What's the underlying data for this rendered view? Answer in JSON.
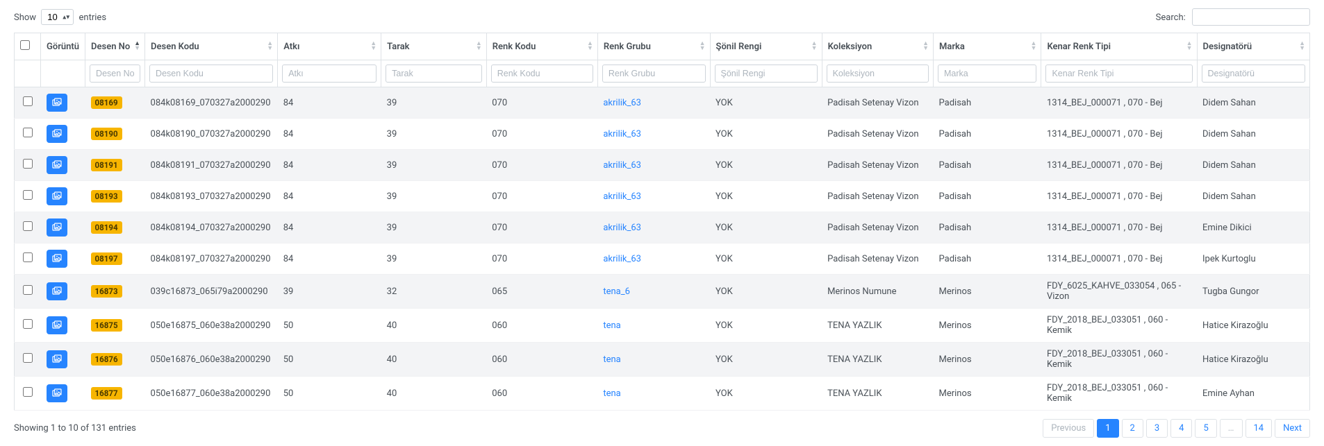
{
  "length": {
    "prefix": "Show",
    "suffix": "entries",
    "value": "10"
  },
  "search": {
    "label": "Search:",
    "value": ""
  },
  "columns": [
    {
      "key": "goruntu",
      "label": "Görüntü",
      "filter": null
    },
    {
      "key": "desenno",
      "label": "Desen No",
      "filter": "Desen No",
      "sorted": "asc"
    },
    {
      "key": "desenkodu",
      "label": "Desen Kodu",
      "filter": "Desen Kodu"
    },
    {
      "key": "atki",
      "label": "Atkı",
      "filter": "Atkı"
    },
    {
      "key": "tarak",
      "label": "Tarak",
      "filter": "Tarak"
    },
    {
      "key": "renkkodu",
      "label": "Renk Kodu",
      "filter": "Renk Kodu"
    },
    {
      "key": "renkgrubu",
      "label": "Renk Grubu",
      "filter": "Renk Grubu"
    },
    {
      "key": "sonilrengi",
      "label": "Şönil Rengi",
      "filter": "Şönil Rengi"
    },
    {
      "key": "koleksiyon",
      "label": "Koleksiyon",
      "filter": "Koleksiyon"
    },
    {
      "key": "marka",
      "label": "Marka",
      "filter": "Marka"
    },
    {
      "key": "kenarrenktipi",
      "label": "Kenar Renk Tipi",
      "filter": "Kenar Renk Tipi"
    },
    {
      "key": "designatoru",
      "label": "Designatörü",
      "filter": "Designatörü"
    }
  ],
  "rows": [
    {
      "badge": "08169",
      "desenno": "08169",
      "desenkodu": "084k08169_070327a2000290",
      "atki": "84",
      "tarak": "39",
      "renkkodu": "070",
      "renkgrubu": "akrilik_63",
      "sonil": "YOK",
      "koleksiyon": "Padisah Setenay Vizon",
      "marka": "Padisah",
      "kenar": "1314_BEJ_000071 , 070 - Bej",
      "design": "Didem Sahan"
    },
    {
      "badge": "08190",
      "desenno": "08190",
      "desenkodu": "084k08190_070327a2000290",
      "atki": "84",
      "tarak": "39",
      "renkkodu": "070",
      "renkgrubu": "akrilik_63",
      "sonil": "YOK",
      "koleksiyon": "Padisah Setenay Vizon",
      "marka": "Padisah",
      "kenar": "1314_BEJ_000071 , 070 - Bej",
      "design": "Didem Sahan"
    },
    {
      "badge": "08191",
      "desenno": "08191",
      "desenkodu": "084k08191_070327a2000290",
      "atki": "84",
      "tarak": "39",
      "renkkodu": "070",
      "renkgrubu": "akrilik_63",
      "sonil": "YOK",
      "koleksiyon": "Padisah Setenay Vizon",
      "marka": "Padisah",
      "kenar": "1314_BEJ_000071 , 070 - Bej",
      "design": "Didem Sahan"
    },
    {
      "badge": "08193",
      "desenno": "08193",
      "desenkodu": "084k08193_070327a2000290",
      "atki": "84",
      "tarak": "39",
      "renkkodu": "070",
      "renkgrubu": "akrilik_63",
      "sonil": "YOK",
      "koleksiyon": "Padisah Setenay Vizon",
      "marka": "Padisah",
      "kenar": "1314_BEJ_000071 , 070 - Bej",
      "design": "Didem Sahan"
    },
    {
      "badge": "08194",
      "desenno": "08194",
      "desenkodu": "084k08194_070327a2000290",
      "atki": "84",
      "tarak": "39",
      "renkkodu": "070",
      "renkgrubu": "akrilik_63",
      "sonil": "YOK",
      "koleksiyon": "Padisah Setenay Vizon",
      "marka": "Padisah",
      "kenar": "1314_BEJ_000071 , 070 - Bej",
      "design": "Emine Dikici"
    },
    {
      "badge": "08197",
      "desenno": "08197",
      "desenkodu": "084k08197_070327a2000290",
      "atki": "84",
      "tarak": "39",
      "renkkodu": "070",
      "renkgrubu": "akrilik_63",
      "sonil": "YOK",
      "koleksiyon": "Padisah Setenay Vizon",
      "marka": "Padisah",
      "kenar": "1314_BEJ_000071 , 070 - Bej",
      "design": "Ipek Kurtoglu"
    },
    {
      "badge": "16873",
      "desenno": "16873",
      "desenkodu": "039c16873_065i79a2000290",
      "atki": "39",
      "tarak": "32",
      "renkkodu": "065",
      "renkgrubu": "tena_6",
      "sonil": "YOK",
      "koleksiyon": "Merinos Numune",
      "marka": "Merinos",
      "kenar": "FDY_6025_KAHVE_033054 , 065 - Vizon",
      "design": "Tugba Gungor"
    },
    {
      "badge": "16875",
      "desenno": "16875",
      "desenkodu": "050e16875_060e38a2000290",
      "atki": "50",
      "tarak": "40",
      "renkkodu": "060",
      "renkgrubu": "tena",
      "sonil": "YOK",
      "koleksiyon": "TENA YAZLIK",
      "marka": "Merinos",
      "kenar": "FDY_2018_BEJ_033051 , 060 - Kemik",
      "design": "Hatice Kirazoğlu"
    },
    {
      "badge": "16876",
      "desenno": "16876",
      "desenkodu": "050e16876_060e38a2000290",
      "atki": "50",
      "tarak": "40",
      "renkkodu": "060",
      "renkgrubu": "tena",
      "sonil": "YOK",
      "koleksiyon": "TENA YAZLIK",
      "marka": "Merinos",
      "kenar": "FDY_2018_BEJ_033051 , 060 - Kemik",
      "design": "Hatice Kirazoğlu"
    },
    {
      "badge": "16877",
      "desenno": "16877",
      "desenkodu": "050e16877_060e38a2000290",
      "atki": "50",
      "tarak": "40",
      "renkkodu": "060",
      "renkgrubu": "tena",
      "sonil": "YOK",
      "koleksiyon": "TENA YAZLIK",
      "marka": "Merinos",
      "kenar": "FDY_2018_BEJ_033051 , 060 - Kemik",
      "design": "Emine Ayhan"
    }
  ],
  "info": "Showing 1 to 10 of 131 entries",
  "pagination": {
    "prev": "Previous",
    "next": "Next",
    "pages": [
      "1",
      "2",
      "3",
      "4",
      "5",
      "…",
      "14"
    ],
    "active": "1"
  }
}
